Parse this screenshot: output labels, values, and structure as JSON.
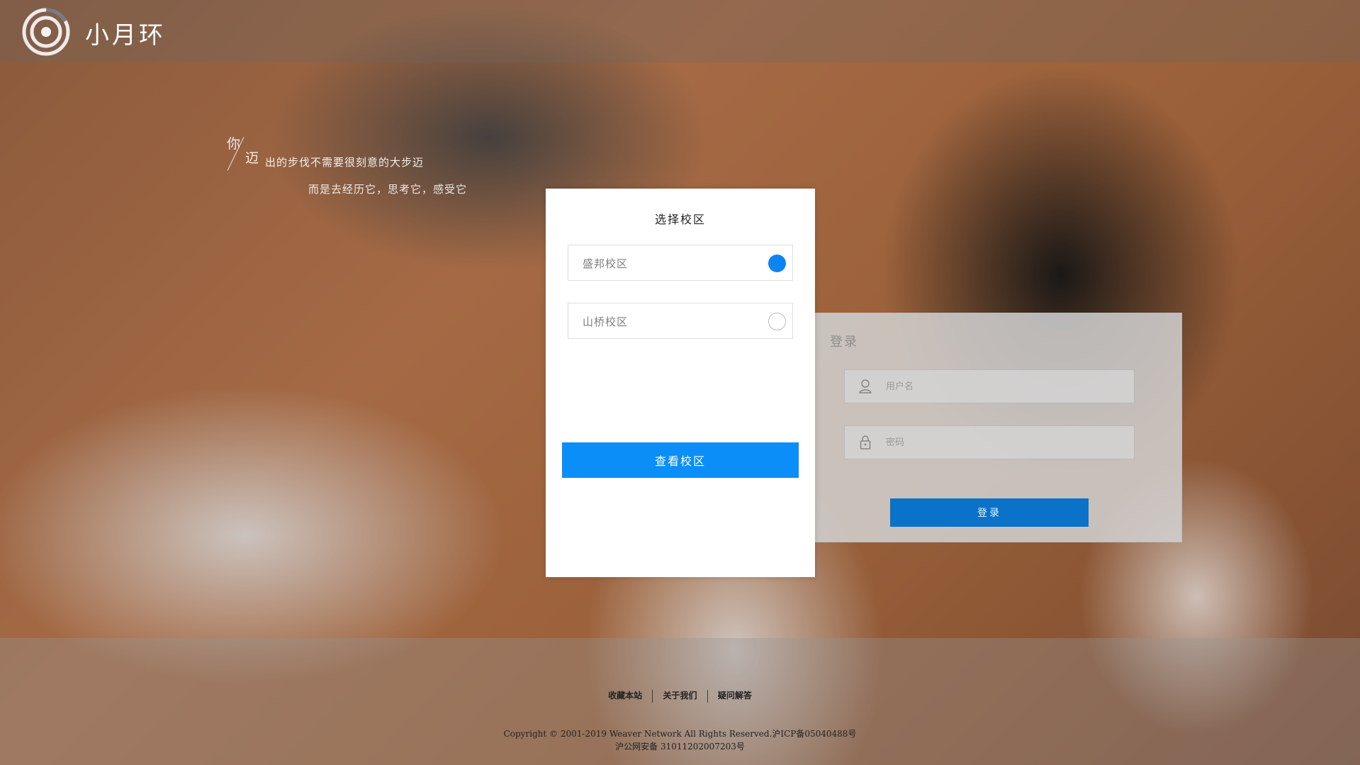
{
  "header": {
    "logo_icon": "circular-logo-icon",
    "brand": "小月环"
  },
  "quote": {
    "ni": "你",
    "mai": "迈",
    "line1": "出的步伐不需要很刻意的大步迈",
    "line2": "而是去经历它，思考它，感受它"
  },
  "campus_dialog": {
    "title": "选择校区",
    "options": [
      {
        "label": "盛邦校区",
        "selected": true
      },
      {
        "label": "山桥校区",
        "selected": false
      }
    ],
    "button_label": "查看校区",
    "accent": "#0b8ef8"
  },
  "login": {
    "title": "登录",
    "username_placeholder": "用户名",
    "password_placeholder": "密码",
    "username_icon": "user-icon",
    "password_icon": "lock-icon",
    "button_label": "登录",
    "button_color": "#0a73c9"
  },
  "footer": {
    "links": [
      "收藏本站",
      "关于我们",
      "疑问解答"
    ],
    "copyright_line1": "Copyright © 2001-2019 Weaver Network All Rights Reserved.沪ICP备05040488号",
    "copyright_line2": "沪公网安备 31011202007203号"
  }
}
